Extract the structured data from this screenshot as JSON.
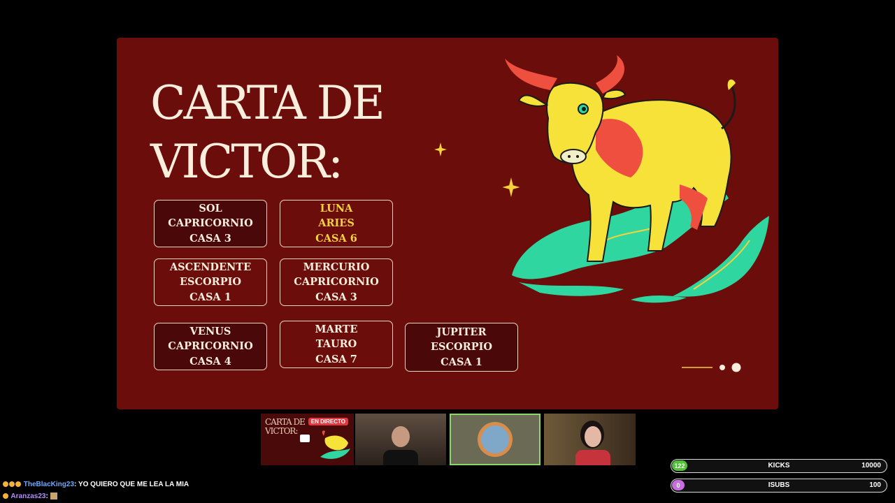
{
  "slide": {
    "title_line1": "CARTA DE",
    "title_line2": "VICTOR:",
    "cards": [
      {
        "l1": "SOL",
        "l2": "CAPRICORNIO",
        "l3": "CASA 3"
      },
      {
        "l1": "LUNA",
        "l2": "ARIES",
        "l3": "CASA 6"
      },
      {
        "l1": "ASCENDENTE",
        "l2": "ESCORPIO",
        "l3": "CASA 1"
      },
      {
        "l1": "MERCURIO",
        "l2": "CAPRICORNIO",
        "l3": "CASA 3"
      },
      {
        "l1": "VENUS",
        "l2": "CAPRICORNIO",
        "l3": "CASA 4"
      },
      {
        "l1": "MARTE",
        "l2": "TAURO",
        "l3": "CASA 7"
      },
      {
        "l1": "JUPITER",
        "l2": "ESCORPIO",
        "l3": "CASA 1"
      }
    ],
    "colors": {
      "background": "#6b0d0a",
      "text": "#fbeedd",
      "highlight": "#f6d23d",
      "bull_yellow": "#f7e23a",
      "bull_red": "#ef4f3f",
      "leaf": "#2fd6a0"
    }
  },
  "thumbnails": {
    "slide_title_line1": "CARTA DE",
    "slide_title_line2": "VICTOR:",
    "live_badge": "EN DIRECTO"
  },
  "chat": [
    {
      "user": "TheBlacKing23",
      "message": ": YO QUIERO QUE ME LEA LA MIA"
    },
    {
      "user": "Aranzas23",
      "message": ":"
    }
  ],
  "goals": [
    {
      "current": "122",
      "label": "KICKS",
      "target": "10000",
      "fill": 0.0122,
      "color": "#53c23a"
    },
    {
      "current": "0",
      "label": "ISUBS",
      "target": "100",
      "fill": 0,
      "color": "#c86fe0"
    }
  ]
}
